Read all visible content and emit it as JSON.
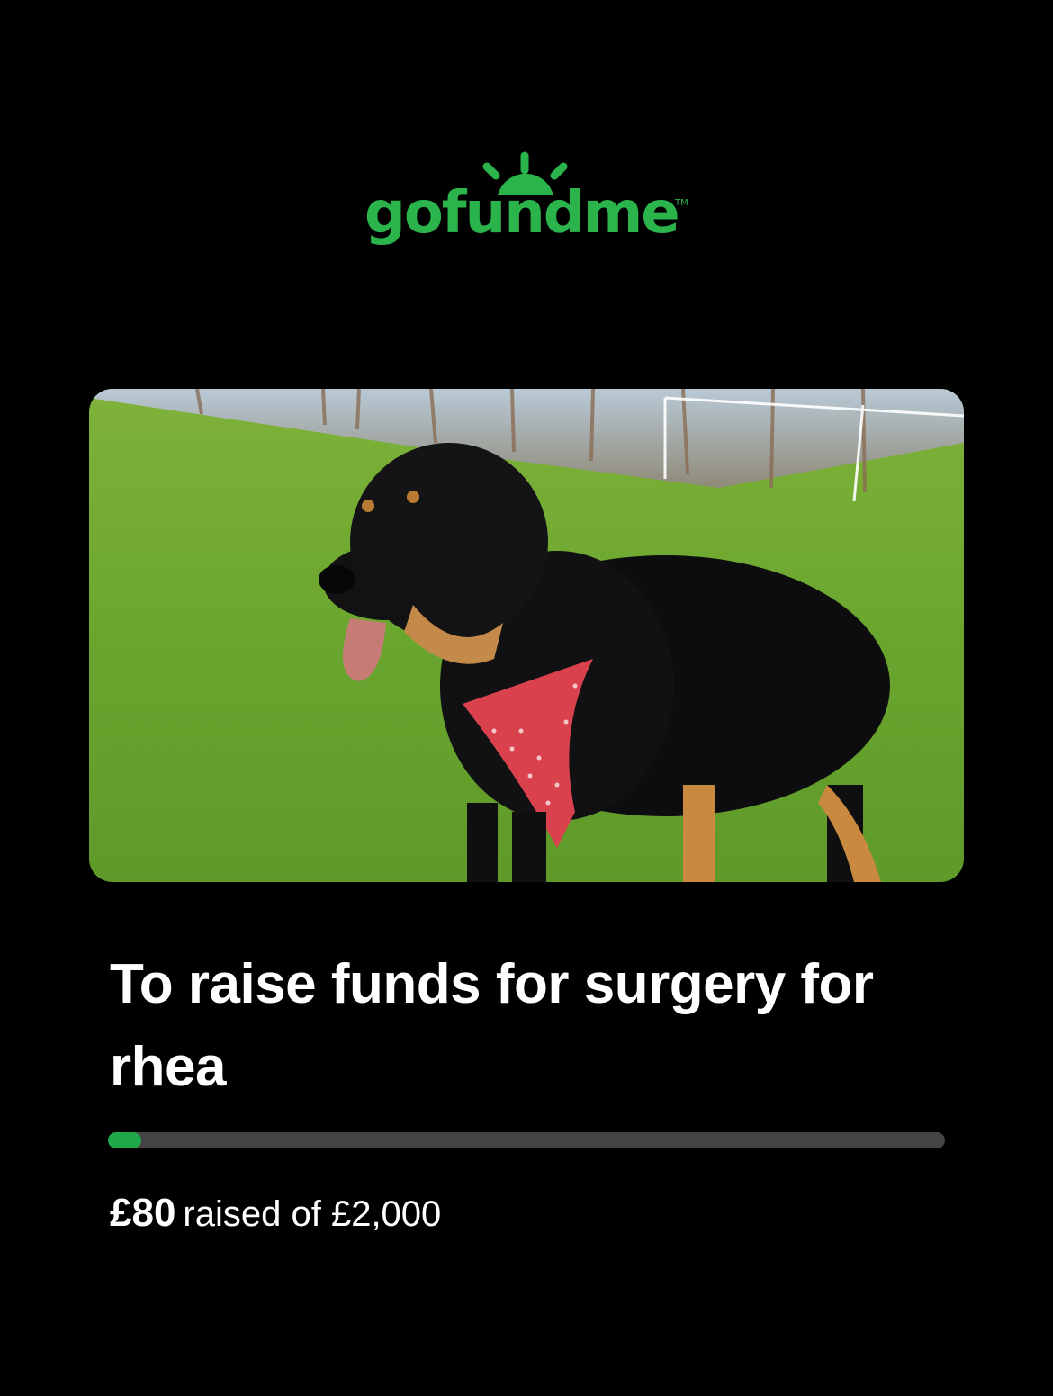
{
  "logo": {
    "text": "gofundme",
    "tm": "TM",
    "color": "#2bb34c"
  },
  "hero": {
    "image": "dog-photo",
    "alt": "black and tan dog in red polka dot harness on grass field"
  },
  "campaign": {
    "title": "To raise funds for surgery for rhea",
    "raised": "£80",
    "goal_text": "raised of £2,000",
    "progress_fraction": 0.04
  },
  "colors": {
    "background": "#000000",
    "accent": "#1fa84a",
    "track": "#444444"
  }
}
